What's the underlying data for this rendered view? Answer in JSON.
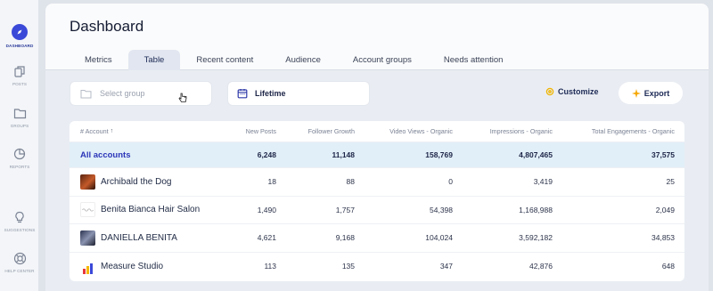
{
  "sidebar": {
    "items": [
      {
        "label": "DASHBOARD",
        "icon": "compass-icon",
        "active": true
      },
      {
        "label": "POSTS",
        "icon": "posts-icon"
      },
      {
        "label": "GROUPS",
        "icon": "folder-icon"
      },
      {
        "label": "REPORTS",
        "icon": "pie-chart-icon"
      },
      {
        "label": "SUGGESTIONS",
        "icon": "lightbulb-icon"
      },
      {
        "label": "HELP CENTER",
        "icon": "lifebuoy-icon"
      }
    ]
  },
  "header": {
    "title": "Dashboard",
    "tabs": [
      "Metrics",
      "Table",
      "Recent content",
      "Audience",
      "Account groups",
      "Needs attention"
    ],
    "active_tab": "Table"
  },
  "filters": {
    "group_placeholder": "Select group",
    "date_range": "Lifetime",
    "customize_label": "Customize",
    "export_label": "Export"
  },
  "table": {
    "columns": [
      "# Account",
      "New Posts",
      "Follower Growth",
      "Video Views - Organic",
      "Impressions - Organic",
      "Total Engagements - Organic"
    ],
    "sort_indicator": "↑",
    "total": {
      "name": "All accounts",
      "values": [
        "6,248",
        "11,148",
        "158,769",
        "4,807,465",
        "37,575"
      ]
    },
    "rows": [
      {
        "name": "Archibald the Dog",
        "values": [
          "18",
          "88",
          "0",
          "3,419",
          "25"
        ]
      },
      {
        "name": "Benita Bianca Hair Salon",
        "values": [
          "1,490",
          "1,757",
          "54,398",
          "1,168,988",
          "2,049"
        ]
      },
      {
        "name": "DANIELLA BENITA",
        "values": [
          "4,621",
          "9,168",
          "104,024",
          "3,592,182",
          "34,853"
        ]
      },
      {
        "name": "Measure Studio",
        "values": [
          "113",
          "135",
          "347",
          "42,876",
          "648"
        ]
      }
    ]
  },
  "colors": {
    "accent": "#3b49d8",
    "total_row_bg": "#e1eff8",
    "customize_icon": "#f0b400",
    "export_icon": "#f5a800"
  }
}
